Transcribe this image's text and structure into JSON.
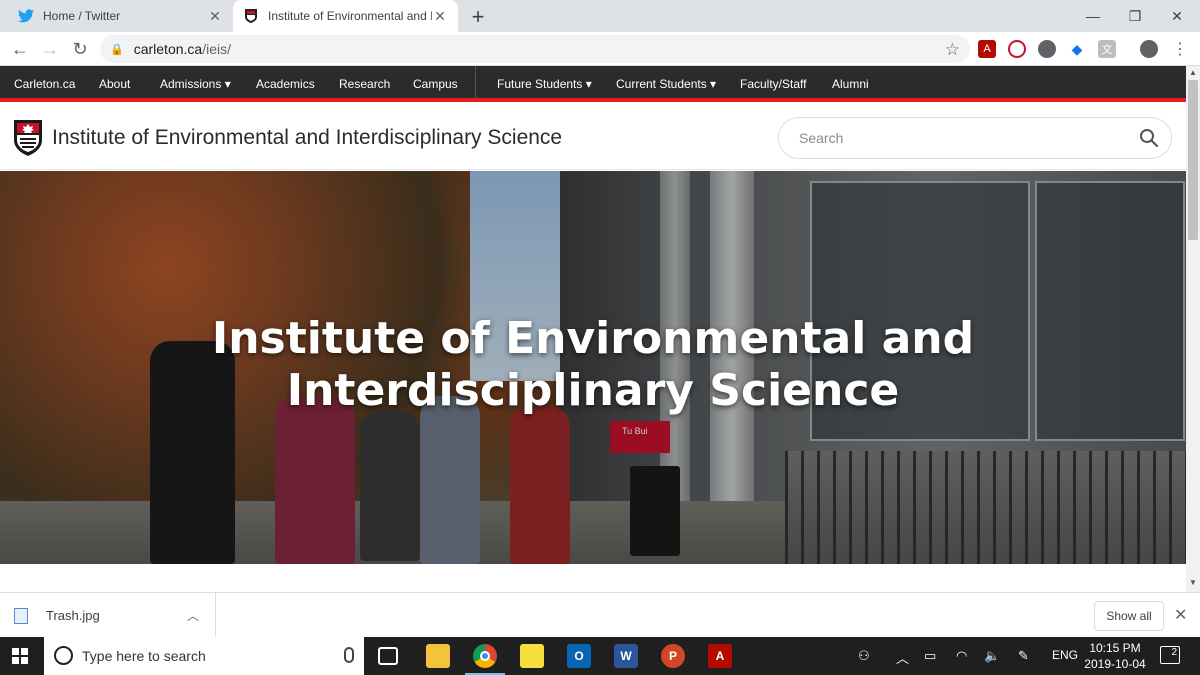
{
  "browser": {
    "tabs": [
      {
        "title": "Home / Twitter",
        "active": false,
        "favicon": "twitter-bird-icon"
      },
      {
        "title": "Institute of Environmental and Ir",
        "active": true,
        "favicon": "carleton-shield-icon"
      }
    ],
    "url": {
      "host": "carleton.ca",
      "path": "/ieis/"
    }
  },
  "site_nav": {
    "items": [
      {
        "label": "Carleton.ca"
      },
      {
        "label": "About"
      },
      {
        "label": "Admissions ▾"
      },
      {
        "label": "Academics"
      },
      {
        "label": "Research"
      },
      {
        "label": "Campus"
      },
      {
        "label": "Future Students ▾"
      },
      {
        "label": "Current Students ▾"
      },
      {
        "label": "Faculty/Staff"
      },
      {
        "label": "Alumni"
      }
    ]
  },
  "header": {
    "site_title": "Institute of Environmental and Interdisciplinary Science",
    "search_placeholder": "Search"
  },
  "hero": {
    "title_line1": "Institute of Environmental and",
    "title_line2": "Interdisciplinary Science",
    "sign_text": "Tu Bui"
  },
  "download_bar": {
    "file_name": "Trash.jpg",
    "show_all_label": "Show all"
  },
  "taskbar": {
    "search_placeholder": "Type here to search",
    "language": "ENG",
    "time": "10:15 PM",
    "date": "2019-10-04",
    "notification_count": "2"
  },
  "colors": {
    "nav_bg": "#2b2b2b",
    "accent_red": "#e91c24"
  }
}
